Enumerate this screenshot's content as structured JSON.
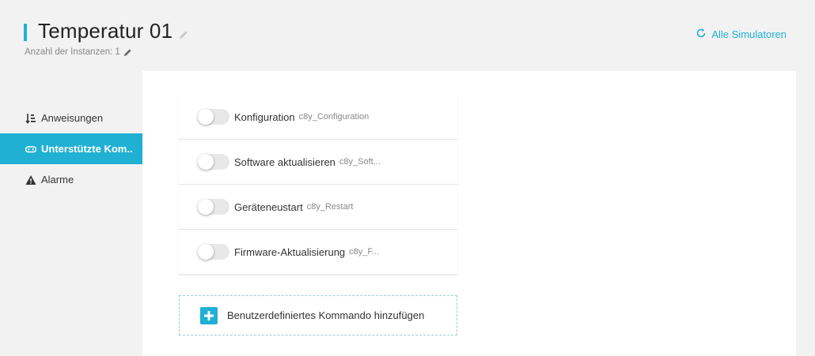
{
  "header": {
    "title": "Temperatur 01",
    "instances_label": "Anzahl der Instanzen: 1",
    "all_simulators_label": "Alle Simulatoren"
  },
  "sidebar": {
    "items": [
      {
        "label": "Anweisungen",
        "icon": "sort-list-icon",
        "active": false
      },
      {
        "label": "Unterstützte Kom..",
        "icon": "gamepad-icon",
        "active": true
      },
      {
        "label": "Alarme",
        "icon": "warning-icon",
        "active": false
      }
    ]
  },
  "commands": [
    {
      "name": "Konfiguration",
      "code": "c8y_Configuration",
      "enabled": false
    },
    {
      "name": "Software aktualisieren",
      "code": "c8y_Soft...",
      "enabled": false
    },
    {
      "name": "Geräteneustart",
      "code": "c8y_Restart",
      "enabled": false
    },
    {
      "name": "Firmware-Aktualisierung",
      "code": "c8y_F...",
      "enabled": false
    }
  ],
  "add_command_label": "Benutzerdefiniertes Kommando hinzufügen",
  "colors": {
    "accent": "#1fb0d4",
    "background": "#f2f2f2",
    "panel": "#ffffff"
  }
}
